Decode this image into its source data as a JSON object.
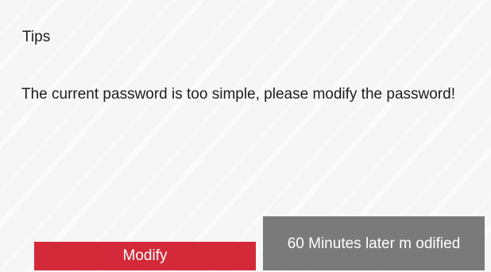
{
  "dialog": {
    "title": "Tips",
    "message": "The current password is too simple, please modify the password!",
    "buttons": {
      "modify_label": "Modify",
      "later_label": "60 Minutes later m odified"
    }
  },
  "colors": {
    "modify_button": "#d42939",
    "later_button": "#7a7a7a",
    "background": "#f6f6f6"
  }
}
